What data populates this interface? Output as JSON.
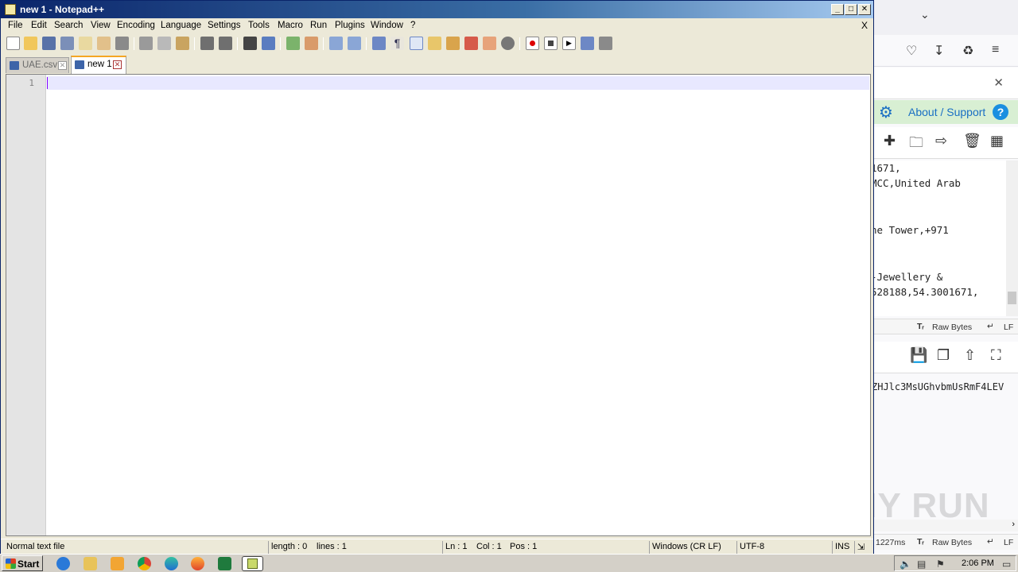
{
  "window": {
    "title": "new 1 - Notepad++",
    "close_doc_glyph": "X"
  },
  "menu": [
    "File",
    "Edit",
    "Search",
    "View",
    "Encoding",
    "Language",
    "Settings",
    "Tools",
    "Macro",
    "Run",
    "Plugins",
    "Window",
    "?"
  ],
  "tabs": [
    {
      "label": "UAE.csv",
      "active": false
    },
    {
      "label": "new 1",
      "active": true
    }
  ],
  "editor": {
    "line_numbers": [
      "1"
    ],
    "content": ""
  },
  "status": {
    "file_type": "Normal text file",
    "length": "length : 0",
    "lines": "lines : 1",
    "ln": "Ln : 1",
    "col": "Col : 1",
    "pos": "Pos : 1",
    "eol": "Windows (CR LF)",
    "encoding": "UTF-8",
    "mode": "INS"
  },
  "browser": {
    "about_label": "About / Support",
    "help_glyph": "?",
    "code_lines": [
      "1671,",
      "MCC,United Arab",
      "",
      "",
      "ne Tower,+971",
      "",
      "",
      "-Jewellery &",
      "528188,54.3001671,"
    ],
    "raw_bytes_label": "Raw Bytes",
    "eol_label": "LF",
    "timing": "1227ms",
    "base64_text": "ZHJlc3MsUGhvbmUsRmF4LEV"
  },
  "watermark": "ANY RUN",
  "taskbar": {
    "start_label": "Start",
    "clock": "2:06 PM"
  },
  "colors": {
    "title_gradient_start": "#0a246a",
    "current_line": "#e8e8ff",
    "caret": "#8000ff",
    "active_tab_accent": "#f5a623",
    "about_band": "#d8efd3",
    "accent_blue": "#1a6fc4"
  }
}
